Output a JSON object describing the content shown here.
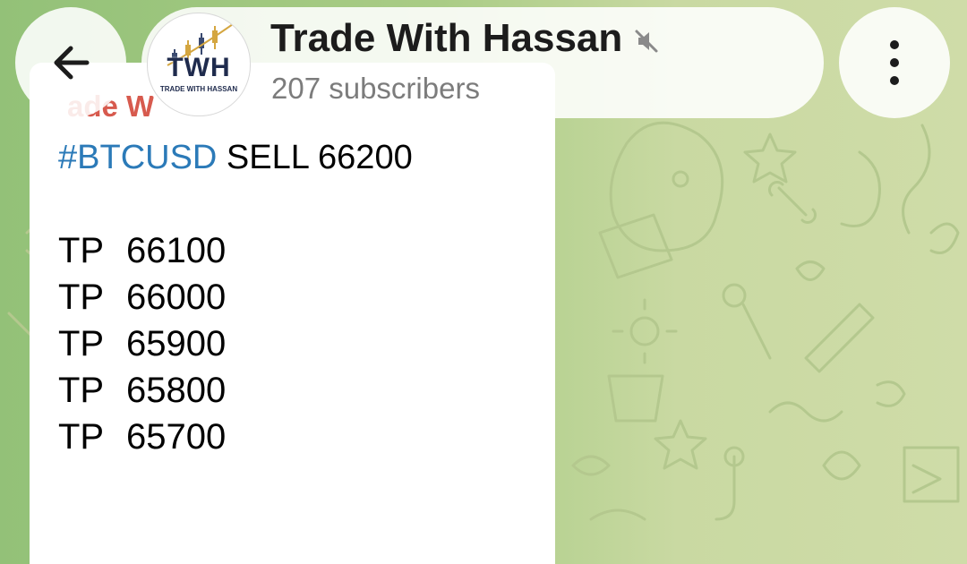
{
  "channel": {
    "title": "Trade With Hassan",
    "subscribers": "207 subscribers",
    "avatar_text": "TWH",
    "avatar_subtext": "TRADE WITH HASSAN",
    "muted": true
  },
  "message": {
    "sender_partial": "ade W",
    "hashtag": "#BTCUSD",
    "signal": " SELL 66200",
    "take_profits": [
      {
        "label": "TP",
        "value": "66100"
      },
      {
        "label": "TP",
        "value": "66000"
      },
      {
        "label": "TP",
        "value": "65900"
      },
      {
        "label": "TP",
        "value": "65800"
      },
      {
        "label": "TP",
        "value": "65700"
      }
    ]
  },
  "icons": {
    "back": "arrow-left-icon",
    "mute": "speaker-muted-icon",
    "menu": "more-vertical-icon"
  },
  "colors": {
    "hashtag": "#2b7ab8",
    "sender": "#d75a4e",
    "wallpaper": "#a9cc85"
  }
}
